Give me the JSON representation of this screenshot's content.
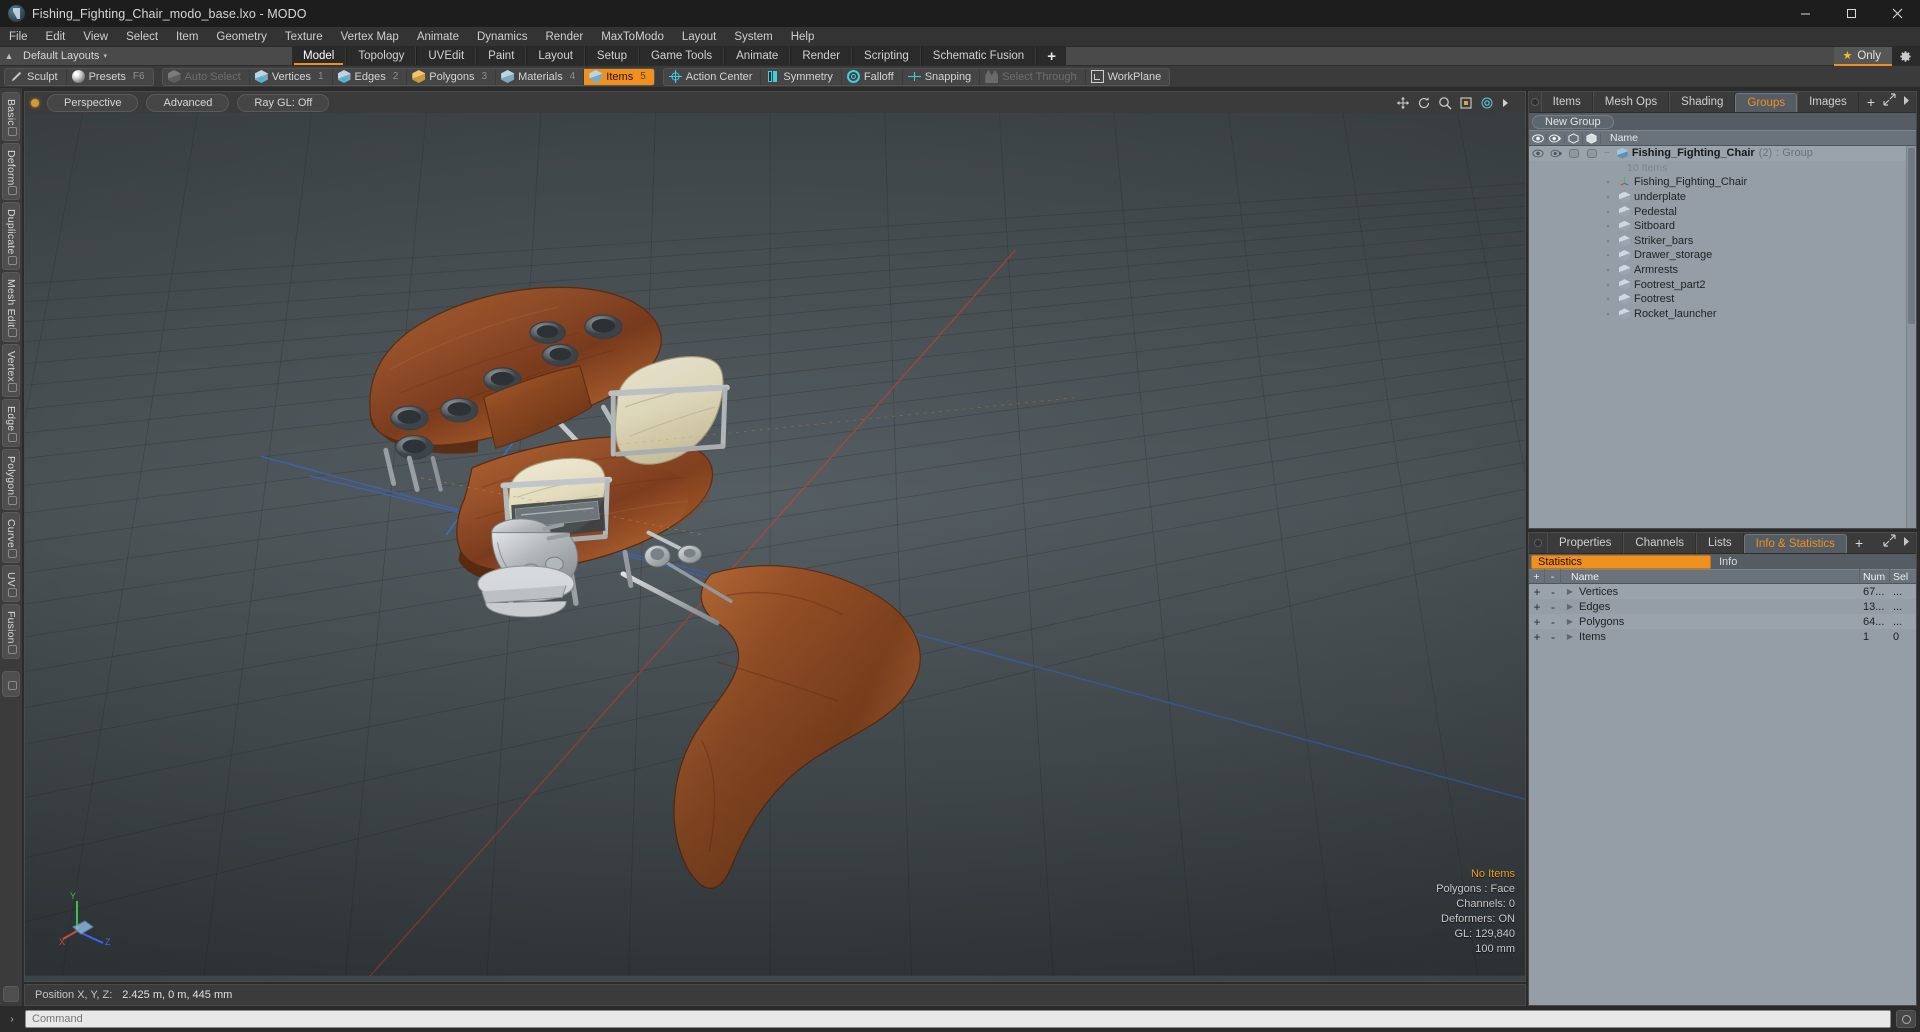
{
  "window": {
    "title": "Fishing_Fighting_Chair_modo_base.lxo - MODO",
    "app_icon": "modo-app-icon",
    "controls": {
      "minimize": "minimize-icon",
      "maximize": "maximize-icon",
      "close": "close-icon"
    }
  },
  "menubar": {
    "items": [
      "File",
      "Edit",
      "View",
      "Select",
      "Item",
      "Geometry",
      "Texture",
      "Vertex Map",
      "Animate",
      "Dynamics",
      "Render",
      "MaxToModo",
      "Layout",
      "System",
      "Help"
    ]
  },
  "layout_row": {
    "preset_label": "Default Layouts",
    "caret": "▾",
    "tabs": [
      {
        "label": "Model",
        "active": true
      },
      {
        "label": "Topology",
        "active": false
      },
      {
        "label": "UVEdit",
        "active": false
      },
      {
        "label": "Paint",
        "active": false
      },
      {
        "label": "Layout",
        "active": false
      },
      {
        "label": "Setup",
        "active": false
      },
      {
        "label": "Game Tools",
        "active": false
      },
      {
        "label": "Animate",
        "active": false
      },
      {
        "label": "Render",
        "active": false
      },
      {
        "label": "Scripting",
        "active": false
      },
      {
        "label": "Schematic Fusion",
        "active": false
      }
    ],
    "add_tab_label": "+",
    "only_label": "Only",
    "star_glyph": "★",
    "gear_icon": "gear-icon",
    "accent_color": "#f0901e"
  },
  "modebar": {
    "group1": [
      {
        "label": "Sculpt",
        "icon": "pen-icon",
        "key": "",
        "state": "normal"
      },
      {
        "label": "Presets",
        "icon": "sphere-icon",
        "key": "F6",
        "state": "normal"
      }
    ],
    "group2": [
      {
        "label": "Auto Select",
        "icon": "cube-grey-icon",
        "key": "",
        "state": "disabled"
      },
      {
        "label": "Vertices",
        "icon": "cube-vertex-icon",
        "key": "1",
        "state": "normal"
      },
      {
        "label": "Edges",
        "icon": "cube-edge-icon",
        "key": "2",
        "state": "normal"
      },
      {
        "label": "Polygons",
        "icon": "cube-polygon-icon",
        "key": "3",
        "state": "normal"
      },
      {
        "label": "Materials",
        "icon": "cube-material-icon",
        "key": "4",
        "state": "normal"
      },
      {
        "label": "Items",
        "icon": "cube-items-icon",
        "key": "5",
        "state": "active"
      }
    ],
    "group3": [
      {
        "label": "Action Center",
        "icon": "action-center-icon",
        "state": "normal"
      },
      {
        "label": "Symmetry",
        "icon": "symmetry-icon",
        "state": "normal"
      },
      {
        "label": "Falloff",
        "icon": "falloff-icon",
        "state": "normal"
      },
      {
        "label": "Snapping",
        "icon": "snapping-icon",
        "state": "normal"
      },
      {
        "label": "Select Through",
        "icon": "select-through-icon",
        "state": "disabled"
      },
      {
        "label": "WorkPlane",
        "icon": "workplane-icon",
        "state": "normal"
      }
    ]
  },
  "left_toolbar": {
    "tabs": [
      "Basic",
      "Deform",
      "Duplicate",
      "Mesh Edit",
      "Vertex",
      "Edge",
      "Polygon",
      "Curve",
      "UV",
      "Fusion"
    ]
  },
  "viewport": {
    "header": {
      "indicator": "active-viewport-dot",
      "pills": [
        "Perspective",
        "Advanced",
        "Ray GL: Off"
      ],
      "icons": [
        "move-view-icon",
        "rotate-view-icon",
        "zoom-view-icon",
        "fit-view-icon",
        "viewport-settings-icon",
        "viewport-menu-icon"
      ]
    },
    "hud": {
      "selection": "No Items",
      "lines": [
        "Polygons : Face",
        "Channels: 0",
        "Deformers: ON",
        "GL: 129,840",
        "100 mm"
      ]
    },
    "axis_gizmo": {
      "x": "X",
      "y": "Y",
      "z": "Z"
    }
  },
  "statusbar": {
    "position_label": "Position X, Y, Z:",
    "position_value": "2.425 m, 0 m, 445 mm"
  },
  "right_panel_top": {
    "tabs": [
      {
        "label": "Items",
        "active": false
      },
      {
        "label": "Mesh Ops",
        "active": false
      },
      {
        "label": "Shading",
        "active": false
      },
      {
        "label": "Groups",
        "active": true
      },
      {
        "label": "Images",
        "active": false
      }
    ],
    "add_tab_label": "+",
    "expand_icon": "expand-panel-icon",
    "menu_icon": "panel-menu-icon",
    "new_group_button": "New Group",
    "columns": {
      "eye": "visibility-icon",
      "render": "render-visibility-icon",
      "lock": "lock-icon",
      "select": "selectable-icon",
      "name": "Name"
    },
    "group": {
      "name": "Fishing_Fighting_Chair",
      "count": "(2)",
      "type": ": Group",
      "sub_label": "10 Items"
    },
    "items": [
      {
        "name": "Fishing_Fighting_Chair",
        "icon": "locator-icon"
      },
      {
        "name": "underplate",
        "icon": "mesh-icon"
      },
      {
        "name": "Pedestal",
        "icon": "mesh-icon"
      },
      {
        "name": "Sitboard",
        "icon": "mesh-icon"
      },
      {
        "name": "Striker_bars",
        "icon": "mesh-icon"
      },
      {
        "name": "Drawer_storage",
        "icon": "mesh-icon"
      },
      {
        "name": "Armrests",
        "icon": "mesh-icon"
      },
      {
        "name": "Footrest_part2",
        "icon": "mesh-icon"
      },
      {
        "name": "Footrest",
        "icon": "mesh-icon"
      },
      {
        "name": "Rocket_launcher",
        "icon": "mesh-icon"
      }
    ]
  },
  "right_panel_bottom": {
    "tabs": [
      {
        "label": "Properties",
        "active": false
      },
      {
        "label": "Channels",
        "active": false
      },
      {
        "label": "Lists",
        "active": false
      },
      {
        "label": "Info & Statistics",
        "active": true
      }
    ],
    "add_tab_label": "+",
    "expand_icon": "expand-panel-icon",
    "menu_icon": "panel-menu-icon",
    "subtabs": [
      {
        "label": "Statistics",
        "active": true
      },
      {
        "label": "Info",
        "active": false
      }
    ],
    "columns": {
      "plus": "+",
      "minus": "-",
      "name": "Name",
      "num": "Num",
      "sel": "Sel"
    },
    "rows": [
      {
        "name": "Vertices",
        "num": "67...",
        "sel": "..."
      },
      {
        "name": "Edges",
        "num": "13...",
        "sel": "..."
      },
      {
        "name": "Polygons",
        "num": "64...",
        "sel": "..."
      },
      {
        "name": "Items",
        "num": "1",
        "sel": "0"
      }
    ]
  },
  "command_bar": {
    "caret": "›",
    "placeholder": "Command",
    "value": "",
    "help_icon": "help-icon"
  }
}
